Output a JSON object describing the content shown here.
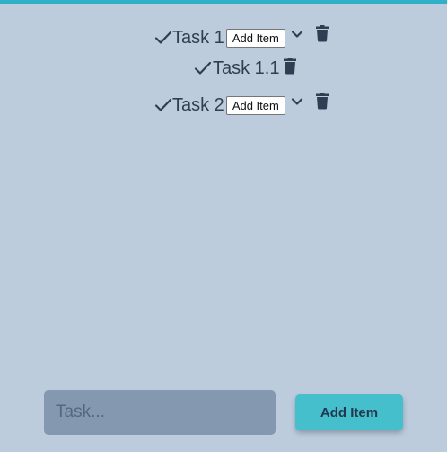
{
  "colors": {
    "background": "#bdccdc",
    "accent": "#2fb0c6",
    "text": "#2f3e52",
    "input_bg": "#8499af",
    "button_bg": "#45bfcb"
  },
  "tasks": [
    {
      "label": "Task 1",
      "add_label": "Add Item",
      "icons": [
        "check-icon",
        "chevron-down-icon",
        "trash-icon"
      ],
      "children": [
        {
          "label": "Task 1.1",
          "icons": [
            "check-icon",
            "trash-icon"
          ]
        }
      ]
    },
    {
      "label": "Task 2",
      "add_label": "Add Item",
      "icons": [
        "check-icon",
        "chevron-down-icon",
        "trash-icon"
      ]
    }
  ],
  "form": {
    "input_placeholder": "Task...",
    "input_value": "",
    "submit_label": "Add Item"
  }
}
